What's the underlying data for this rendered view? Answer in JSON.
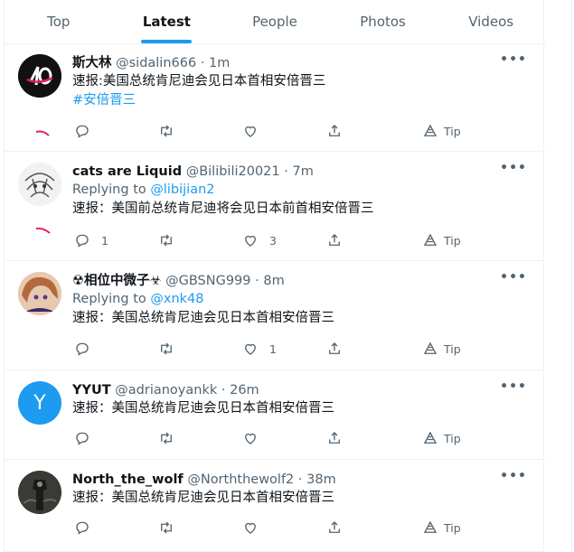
{
  "tabs": [
    "Top",
    "Latest",
    "People",
    "Photos",
    "Videos"
  ],
  "active_tab": "Latest",
  "more_glyph": "•••",
  "tip_label": "Tip",
  "tweets": [
    {
      "name": "斯大林",
      "handle": "@sidalin666",
      "dot": "·",
      "time": "1m",
      "replying_prefix": "",
      "replying_to": "",
      "text": "速报:美国总统肯尼迪会见日本首相安倍晋三",
      "hashtag": "#安倍晋三",
      "reply_count": "",
      "like_count": "",
      "avatar_kind": "logo"
    },
    {
      "name": "cats are Liquid",
      "handle": "@Bilibili20021",
      "dot": "·",
      "time": "7m",
      "replying_prefix": "Replying to",
      "replying_to": "@libijian2",
      "text": "速报：美国前总统肯尼迪将会见日本前首相安倍晋三",
      "hashtag": "",
      "reply_count": "1",
      "like_count": "3",
      "avatar_kind": "sketch"
    },
    {
      "name": "☢相位中微子☣",
      "handle": "@GBSNG999",
      "dot": "·",
      "time": "8m",
      "replying_prefix": "Replying to",
      "replying_to": "@xnk48",
      "text": "速报：美国总统肯尼迪会见日本首相安倍晋三",
      "hashtag": "",
      "reply_count": "",
      "like_count": "1",
      "avatar_kind": "anime"
    },
    {
      "name": "YYUT",
      "handle": "@adrianoyankk",
      "dot": "·",
      "time": "26m",
      "replying_prefix": "",
      "replying_to": "",
      "text": "速报：美国总统肯尼迪会见日本首相安倍晋三",
      "hashtag": "",
      "reply_count": "",
      "like_count": "",
      "avatar_kind": "letter",
      "avatar_letter": "Y"
    },
    {
      "name": "North_the_wolf",
      "handle": "@Norththewolf2",
      "dot": "·",
      "time": "38m",
      "replying_prefix": "",
      "replying_to": "",
      "text": "速报：美国总统肯尼迪会见日本首相安倍晋三",
      "hashtag": "",
      "reply_count": "",
      "like_count": "",
      "avatar_kind": "dark"
    }
  ],
  "colors": {
    "accent": "#1d9bf0",
    "secondary_text": "#536471",
    "divider": "#eff3f4",
    "avatar_letter_bg": "#1d9bf0",
    "mark_red": "#e0245e"
  }
}
